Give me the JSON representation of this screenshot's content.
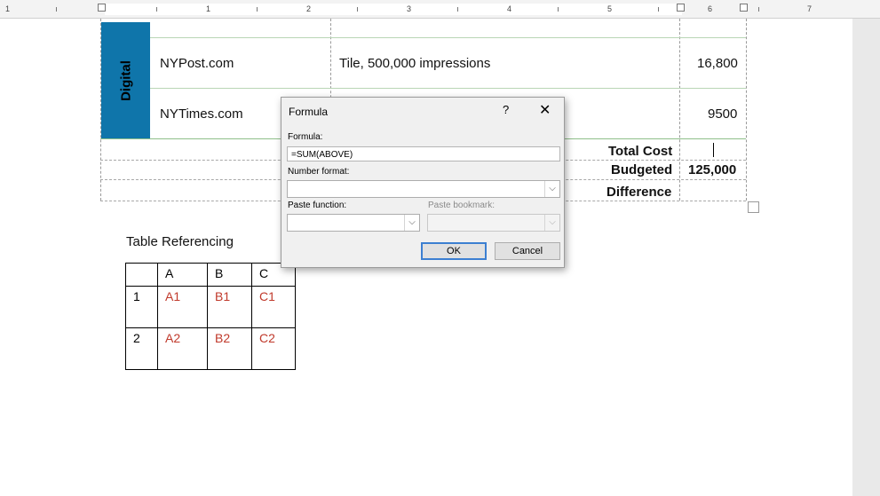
{
  "ruler": {
    "numbers": [
      "1",
      "1",
      "2",
      "3",
      "4",
      "5",
      "6",
      "7"
    ]
  },
  "table": {
    "category": "Digital",
    "rows": [
      {
        "site": "NYPost.com",
        "description": "Tile, 500,000 impressions",
        "cost": "16,800"
      },
      {
        "site": "NYTimes.com",
        "description": "",
        "cost": "9500"
      }
    ],
    "summary": [
      {
        "label": "Total Cost",
        "value": ""
      },
      {
        "label": "Budgeted",
        "value": "125,000"
      },
      {
        "label": "Difference",
        "value": ""
      }
    ]
  },
  "reference": {
    "title": "Table Referencing",
    "headers": [
      "",
      "A",
      "B",
      "C"
    ],
    "rows": [
      [
        "1",
        "A1",
        "B1",
        "C1"
      ],
      [
        "2",
        "A2",
        "B2",
        "C2"
      ]
    ]
  },
  "dialog": {
    "title": "Formula",
    "help": "?",
    "close": "✕",
    "formula_label": "Formula:",
    "formula_value": "=SUM(ABOVE)",
    "number_format_label": "Number format:",
    "number_format_value": "",
    "paste_function_label": "Paste function:",
    "paste_bookmark_label": "Paste bookmark:",
    "ok_label": "OK",
    "cancel_label": "Cancel"
  }
}
